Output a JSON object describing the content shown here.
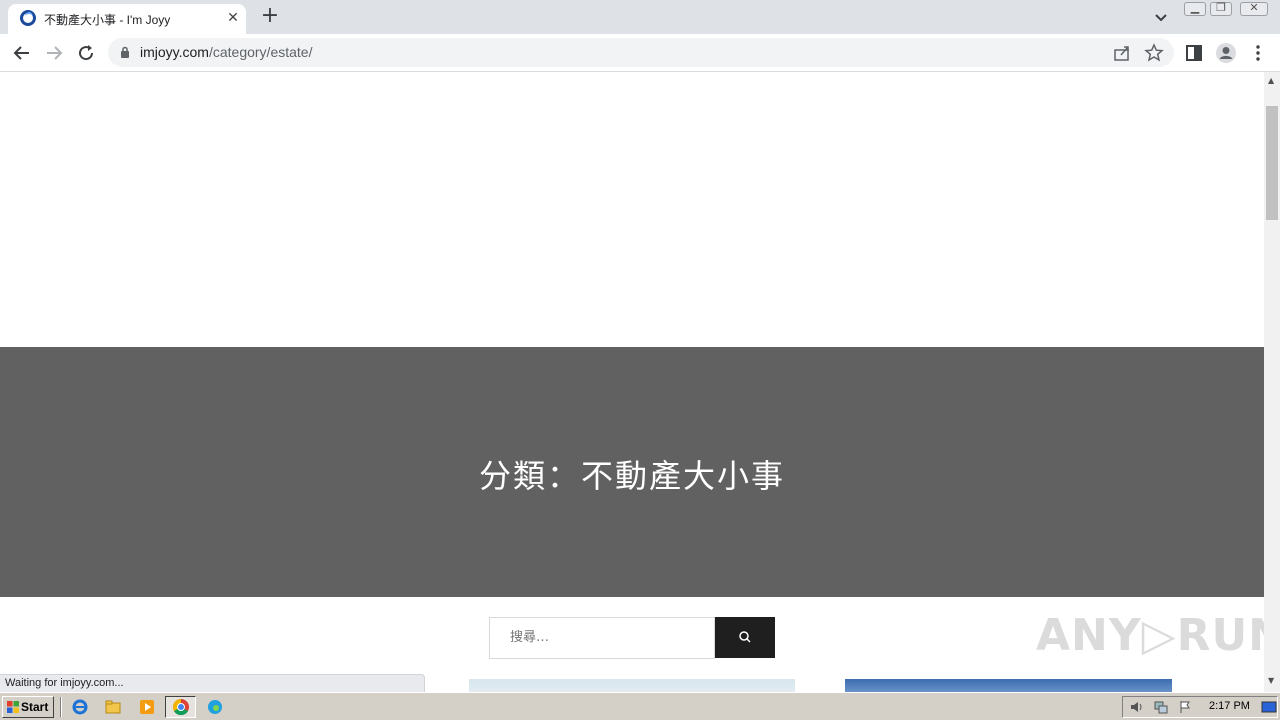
{
  "browser": {
    "tab": {
      "title": "不動產大小事 - I'm Joyy",
      "close_glyph": "✕"
    },
    "new_tab_glyph": "+",
    "url_host": "imjoyy.com",
    "url_path": "/category/estate/"
  },
  "page": {
    "hero_title": "分類：不動產大小事",
    "search_placeholder": "搜尋…",
    "watermark": "ANY▷RUN",
    "status": "Waiting for imjoyy.com..."
  },
  "taskbar": {
    "start_label": "Start",
    "clock": "2:17 PM"
  },
  "colors": {
    "hero_bg": "#616161",
    "search_button_bg": "#1f1f1f",
    "tabstrip_bg": "#dee1e6",
    "taskbar_bg": "#d4d0c8"
  }
}
